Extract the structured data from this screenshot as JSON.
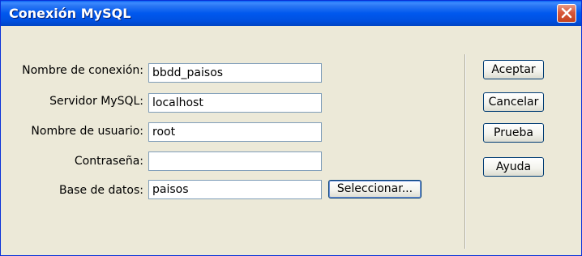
{
  "window": {
    "title": "Conexión MySQL",
    "close_icon": "close-icon"
  },
  "form": {
    "connection_name": {
      "label": "Nombre de conexión:",
      "value": "bbdd_paisos"
    },
    "mysql_server": {
      "label": "Servidor MySQL:",
      "value": "localhost"
    },
    "username": {
      "label": "Nombre de usuario:",
      "value": "root"
    },
    "password": {
      "label": "Contraseña:",
      "value": ""
    },
    "database": {
      "label": "Base de datos:",
      "value": "paisos",
      "select_label": "Seleccionar..."
    }
  },
  "buttons": {
    "accept": "Aceptar",
    "cancel": "Cancelar",
    "test": "Prueba",
    "help": "Ayuda"
  },
  "colors": {
    "titlebar": "#0058ee",
    "window_bg": "#ece9d8",
    "close_button": "#d8583a"
  }
}
